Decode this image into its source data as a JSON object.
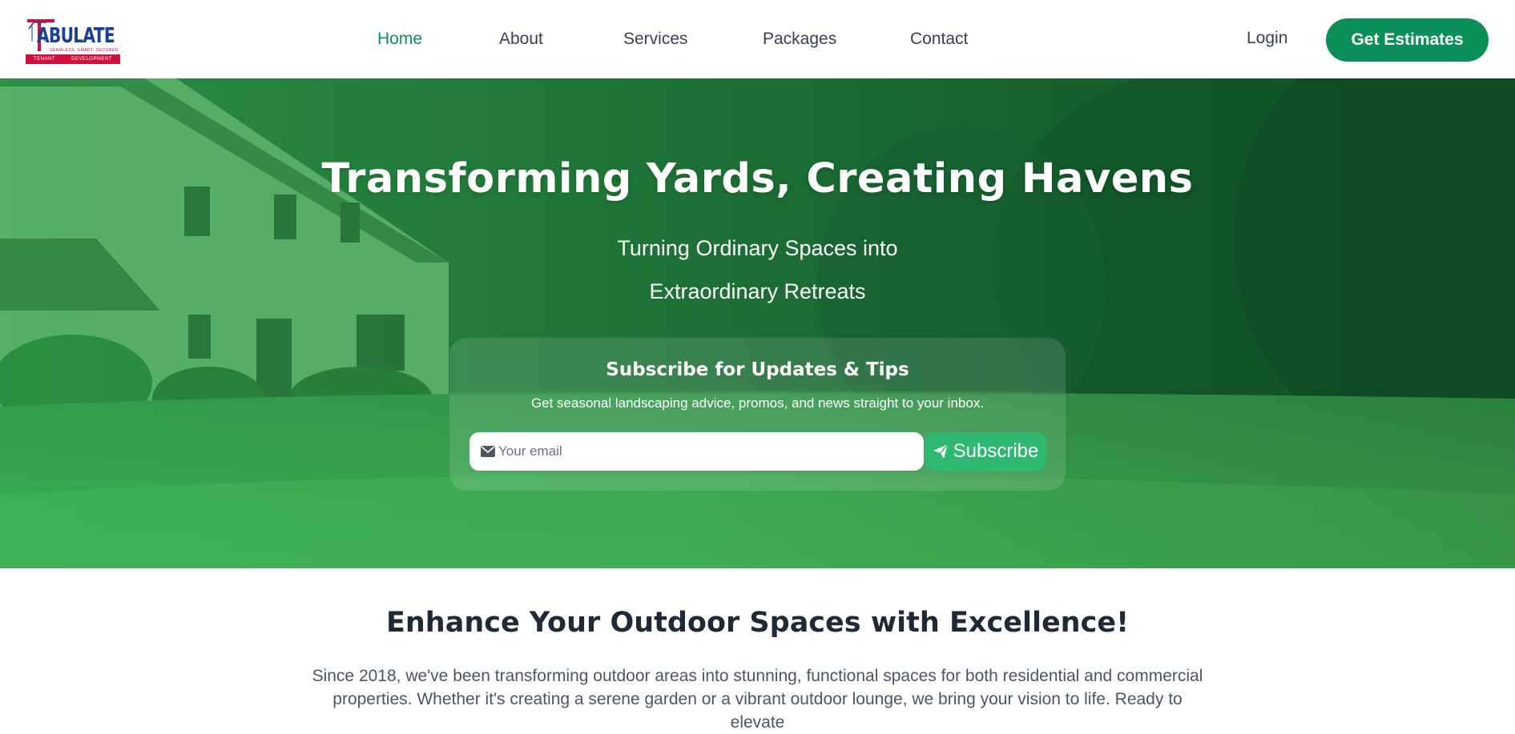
{
  "brand": {
    "logo_text": "ABULATE",
    "logo_tagline": "SEAMLESS. SMART. SECURED",
    "logo_left": "TENANT",
    "logo_right": "DEVELOPMENT",
    "colors": {
      "blue": "#1a3f9b",
      "red": "#d0103a"
    }
  },
  "nav": {
    "items": [
      {
        "label": "Home",
        "active": true
      },
      {
        "label": "About",
        "active": false
      },
      {
        "label": "Services",
        "active": false
      },
      {
        "label": "Packages",
        "active": false
      },
      {
        "label": "Contact",
        "active": false
      }
    ],
    "login_label": "Login",
    "cta_label": "Get Estimates"
  },
  "hero": {
    "title": "Transforming Yards, Creating Havens",
    "subtitle_line1": "Turning Ordinary Spaces into",
    "subtitle_line2": "Extraordinary Retreats"
  },
  "subscribe": {
    "title": "Subscribe for Updates & Tips",
    "description": "Get seasonal landscaping advice, promos, and news straight to your inbox.",
    "email_placeholder": "Your email",
    "email_value": "",
    "button_label": "Subscribe",
    "email_icon": "envelope-icon",
    "button_icon": "paper-plane-icon"
  },
  "intro": {
    "title": "Enhance Your Outdoor Spaces with Excellence!",
    "body": "Since 2018, we've been transforming outdoor areas into stunning, functional spaces for both residential and commercial properties. Whether it's creating a serene garden or a vibrant outdoor lounge, we bring your vision to life. Ready to elevate"
  },
  "colors": {
    "accent": "#0b8f5a",
    "subscribe_button": "#2eb872",
    "text_dark": "#1f2937"
  }
}
